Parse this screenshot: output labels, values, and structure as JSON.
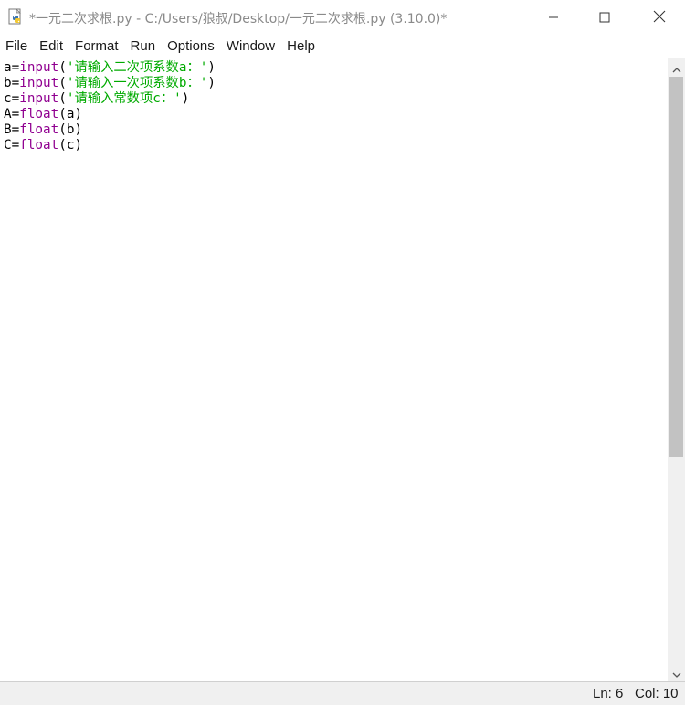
{
  "window": {
    "title": "*一元二次求根.py - C:/Users/狼叔/Desktop/一元二次求根.py (3.10.0)*",
    "app_icon": "python-idle-icon",
    "controls": {
      "minimize_icon": "minimize-icon",
      "maximize_icon": "maximize-icon",
      "close_icon": "close-icon"
    }
  },
  "menu": {
    "items": [
      "File",
      "Edit",
      "Format",
      "Run",
      "Options",
      "Window",
      "Help"
    ]
  },
  "editor": {
    "lines": [
      {
        "var": "a=",
        "func": "input",
        "open": "(",
        "string": "'请输入二次项系数a：'",
        "close": ")"
      },
      {
        "var": "b=",
        "func": "input",
        "open": "(",
        "string": "'请输入一次项系数b：'",
        "close": ")"
      },
      {
        "var": "c=",
        "func": "input",
        "open": "(",
        "string": "'请输入常数项c：'",
        "close": ")"
      },
      {
        "var": "A=",
        "func": "float",
        "open": "(a)",
        "string": "",
        "close": ""
      },
      {
        "var": "B=",
        "func": "float",
        "open": "(b)",
        "string": "",
        "close": ""
      },
      {
        "var": "C=",
        "func": "float",
        "open": "(c)",
        "string": "",
        "close": ""
      }
    ],
    "colors": {
      "keyword": "#900090",
      "string": "#00aa00",
      "default": "#000000"
    }
  },
  "scrollbar": {
    "up_icon": "scroll-up-arrow-icon",
    "down_icon": "scroll-down-arrow-icon"
  },
  "status": {
    "ln": "Ln: 6",
    "col": "Col: 10"
  }
}
